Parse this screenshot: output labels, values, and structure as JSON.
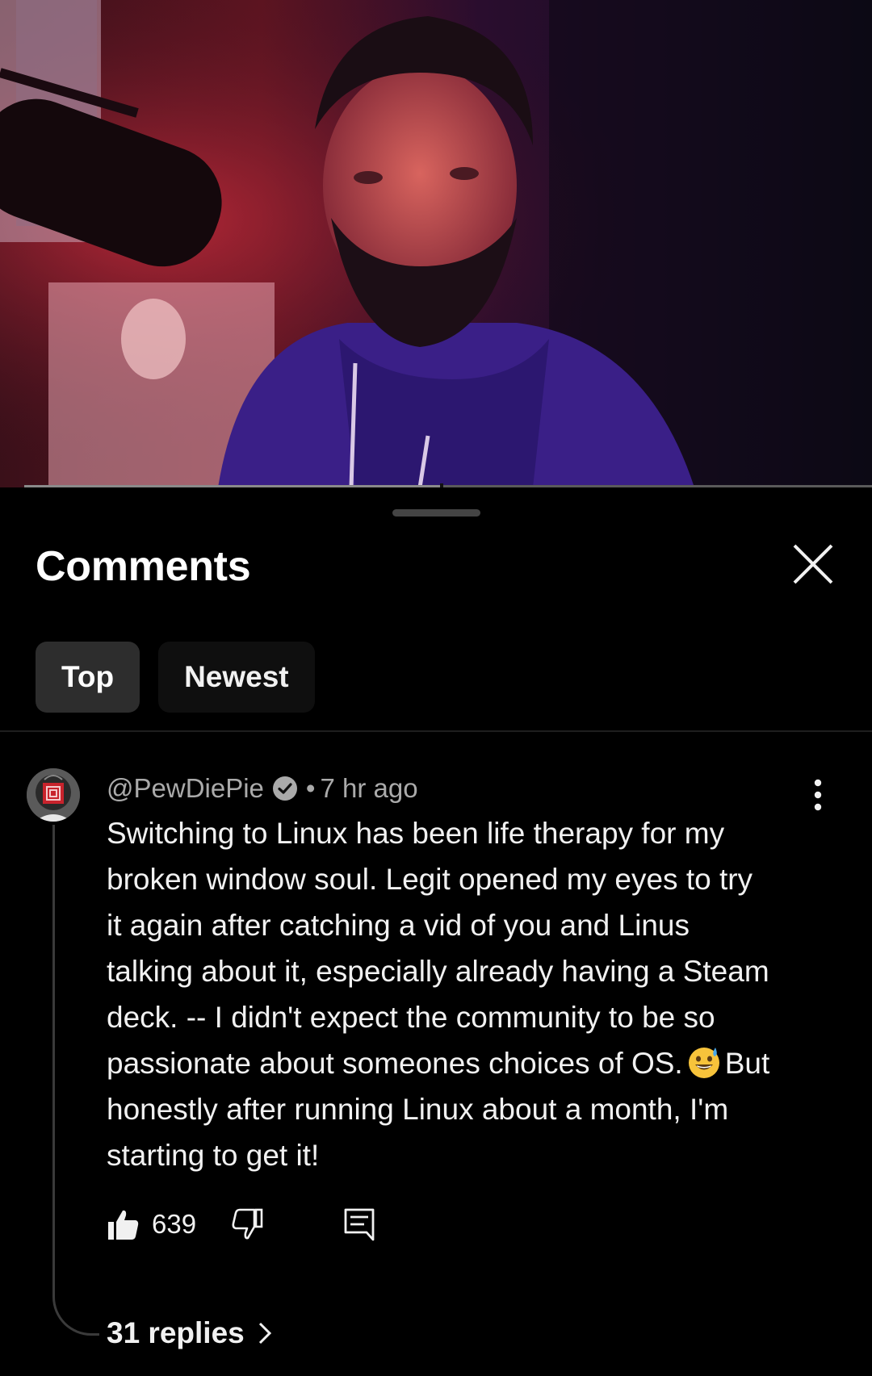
{
  "video": {
    "progress_fraction": 0.49
  },
  "sheet": {
    "title": "Comments"
  },
  "sort_chips": [
    {
      "label": "Top",
      "active": true
    },
    {
      "label": "Newest",
      "active": false
    }
  ],
  "comment": {
    "author": "@PewDiePie",
    "verified": true,
    "separator": "•",
    "time": "7 hr ago",
    "lines": [
      "Switching to Linux has been life therapy for my",
      "broken window soul. Legit opened my eyes to try",
      "it again after catching a vid of you and Linus",
      "talking about it, especially already having a Steam",
      "deck. -- I didn't expect the community to be so",
      "passionate about someones choices of OS.",
      "honestly after running Linux about a month, I'm",
      "starting to get it!"
    ],
    "line6_after_emoji": "But",
    "emoji": "grinning-face-with-sweat",
    "like_count": "639",
    "replies_label": "31 replies"
  },
  "icons": {
    "close": "close-icon",
    "verified": "verified-check-icon",
    "more": "more-vertical-icon",
    "like": "thumbs-up-icon",
    "dislike": "thumbs-down-icon",
    "reply": "reply-comment-icon",
    "chevron": "chevron-right-icon"
  }
}
